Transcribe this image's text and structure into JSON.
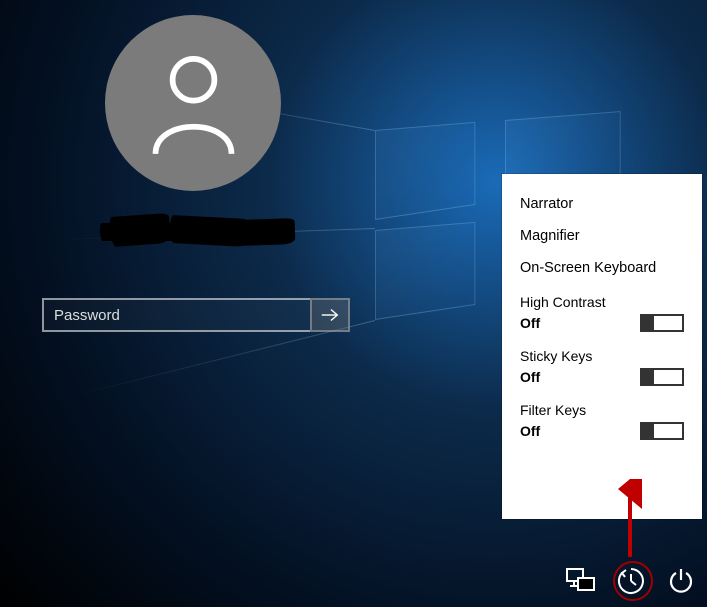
{
  "login": {
    "password_placeholder": "Password"
  },
  "flyout": {
    "items": [
      "Narrator",
      "Magnifier",
      "On-Screen Keyboard"
    ],
    "toggles": [
      {
        "label": "High Contrast",
        "state": "Off"
      },
      {
        "label": "Sticky Keys",
        "state": "Off"
      },
      {
        "label": "Filter Keys",
        "state": "Off"
      }
    ]
  }
}
